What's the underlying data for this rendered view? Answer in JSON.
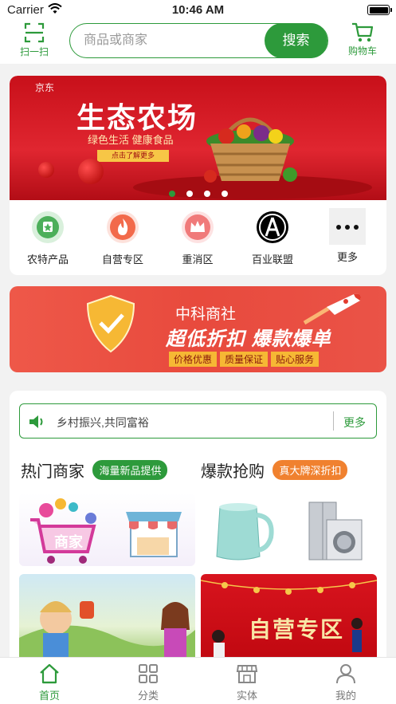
{
  "status_bar": {
    "carrier": "Carrier",
    "time": "10:46 AM"
  },
  "header": {
    "scan_label": "扫一扫",
    "search_placeholder": "商品或商家",
    "search_button": "搜索",
    "cart_label": "购物车"
  },
  "banner": {
    "brand": "京东",
    "title": "生态农场",
    "subtitle": "绿色生活  健康食品",
    "cta": "点击了解更多",
    "slide_count": 4,
    "active_slide": 1
  },
  "quick_nav": [
    {
      "label": "农特产品",
      "icon": "farm-product-icon"
    },
    {
      "label": "自营专区",
      "icon": "fire-icon"
    },
    {
      "label": "重消区",
      "icon": "crown-icon"
    },
    {
      "label": "百业联盟",
      "icon": "alliance-logo-icon"
    },
    {
      "label": "更多",
      "icon": "more-dots-icon"
    }
  ],
  "promo": {
    "title": "中科商社",
    "headline": "超低折扣 爆款爆单",
    "tags": [
      "价格优惠",
      "质量保证",
      "贴心服务"
    ]
  },
  "notice": {
    "text": "乡村振兴,共同富裕",
    "more": "更多"
  },
  "sections": {
    "hot_merchants": {
      "title": "热门商家",
      "tag": "海量新品提供"
    },
    "flash_sale": {
      "title": "爆款抢购",
      "tag": "真大牌深折扣"
    }
  },
  "tiles": {
    "merchant_text": "商家",
    "self_operated_text": "自营专区"
  },
  "tabbar": [
    {
      "label": "首页",
      "icon": "home-icon",
      "active": true
    },
    {
      "label": "分类",
      "icon": "grid-icon",
      "active": false
    },
    {
      "label": "实体",
      "icon": "store-icon",
      "active": false
    },
    {
      "label": "我的",
      "icon": "user-icon",
      "active": false
    }
  ],
  "colors": {
    "brand_green": "#2d9a3b",
    "accent_red": "#e02630",
    "accent_orange": "#f0812f"
  }
}
